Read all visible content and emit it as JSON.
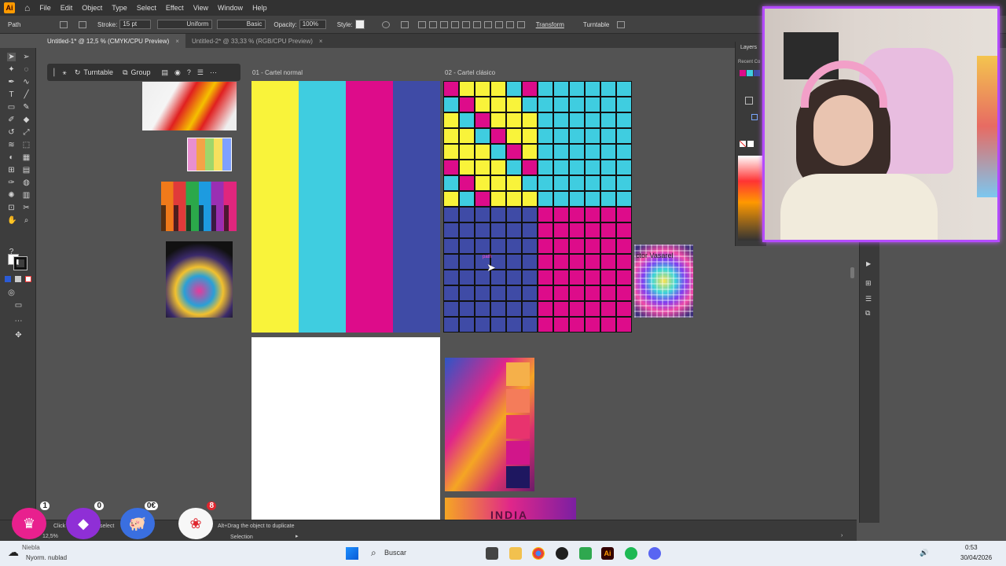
{
  "app": {
    "logo": "Ai",
    "menu": [
      "File",
      "Edit",
      "Object",
      "Type",
      "Select",
      "Effect",
      "View",
      "Window",
      "Help"
    ]
  },
  "control": {
    "selection_type": "Path",
    "stroke_label": "Stroke:",
    "stroke_value": "15 pt",
    "profile": "Uniform",
    "brush": "Basic",
    "opacity_label": "Opacity:",
    "opacity_value": "100%",
    "style_label": "Style:",
    "transform": "Transform",
    "turntable": "Turntable"
  },
  "tabs": [
    {
      "label": "Untitled-1* @ 12,5 % (CMYK/CPU Preview)"
    },
    {
      "label": "Untitled-2* @ 33,33 % (RGB/CPU Preview)"
    }
  ],
  "taskbar": {
    "turntable": "Turntable",
    "group": "Group"
  },
  "artboards": {
    "a1": "01 - Cartel normal",
    "a2": "02 - Cartel clásico"
  },
  "cursor_label": "path",
  "vasarely_label": "ctor Vasarel",
  "india_label": "INDIA",
  "panels": {
    "layers": "Layers",
    "recent_colors": "Recent Co"
  },
  "status": {
    "zoom": "12,5%",
    "hint": "Alt+Drag the object to duplicate",
    "click_hint": "Click",
    "select_hint": "select",
    "tool_name": "Selection",
    "weather": "Niebla",
    "weather_sub": "Nyorm. nublad"
  },
  "overlay": {
    "crown_count": "1",
    "gem_count": "0",
    "pig_amount": "0€",
    "rose_count": "8"
  },
  "windows": {
    "search": "Buscar",
    "time": "0:53",
    "date": "30/04/2026"
  },
  "colors": {
    "yellow": "#f9f33a",
    "cyan": "#3fcde0",
    "magenta": "#dd0c8a",
    "blue": "#3f4ba6",
    "webcam_border": "#b44bff"
  }
}
